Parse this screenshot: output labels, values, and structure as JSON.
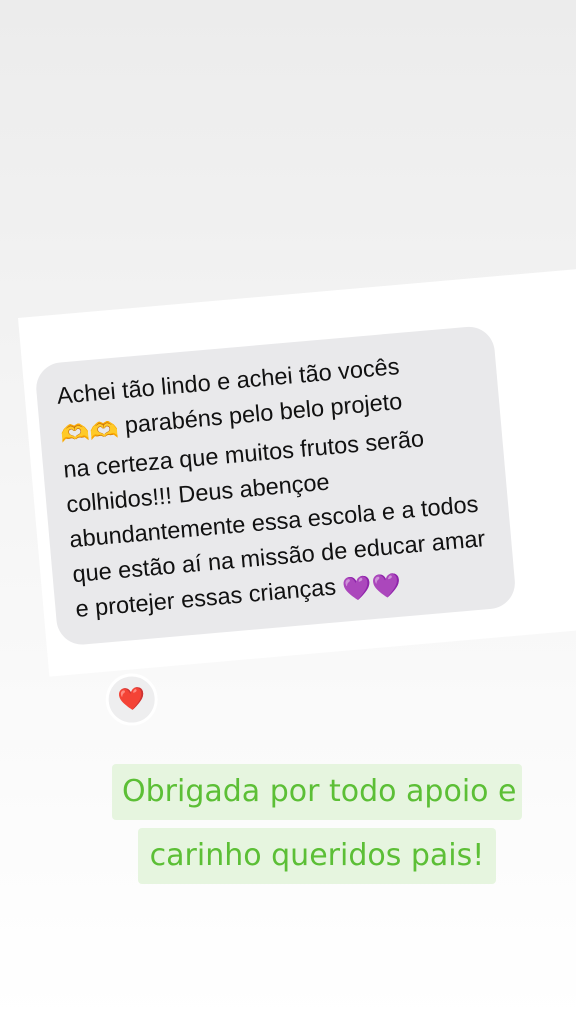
{
  "message": {
    "text_line_1": "Achei tão lindo e achei tão vocês",
    "text_line_2_emojis": "🫶🫶",
    "text_line_2": " parabéns pelo belo projeto",
    "text_rest": "na certeza que muitos frutos serão colhidos!!! Deus abençoe abundantemente essa escola e a todos que estão aí na missão de educar amar e protejer essas crianças",
    "trailing_emojis": "💜💜",
    "reaction": "❤️"
  },
  "caption": {
    "line_1": "Obrigada por todo apoio e",
    "line_2": "carinho queridos pais!"
  },
  "colors": {
    "bubble": "#e9e9eb",
    "caption_text": "#5cbf36",
    "caption_bg": "#e6f5df"
  }
}
